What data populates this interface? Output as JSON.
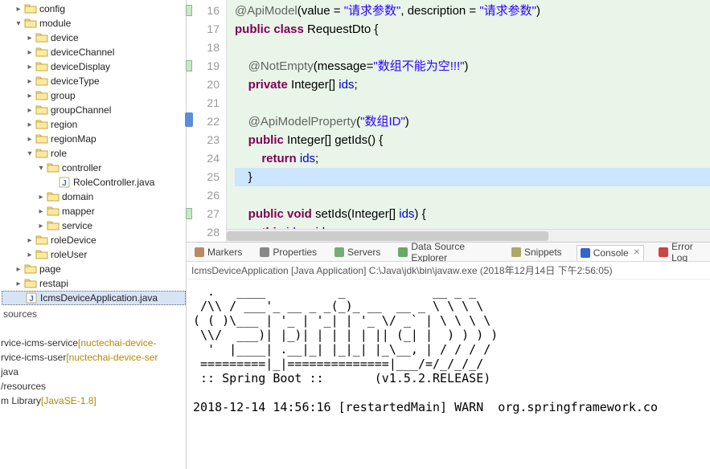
{
  "tree": {
    "nodes": [
      {
        "depth": 1,
        "tw": ">",
        "type": "folder",
        "label": "config"
      },
      {
        "depth": 1,
        "tw": "v",
        "type": "folder",
        "label": "module"
      },
      {
        "depth": 2,
        "tw": ">",
        "type": "folder",
        "label": "device"
      },
      {
        "depth": 2,
        "tw": ">",
        "type": "folder",
        "label": "deviceChannel"
      },
      {
        "depth": 2,
        "tw": ">",
        "type": "folder",
        "label": "deviceDisplay"
      },
      {
        "depth": 2,
        "tw": ">",
        "type": "folder",
        "label": "deviceType"
      },
      {
        "depth": 2,
        "tw": ">",
        "type": "folder",
        "label": "group"
      },
      {
        "depth": 2,
        "tw": ">",
        "type": "folder",
        "label": "groupChannel"
      },
      {
        "depth": 2,
        "tw": ">",
        "type": "folder",
        "label": "region"
      },
      {
        "depth": 2,
        "tw": ">",
        "type": "folder",
        "label": "regionMap"
      },
      {
        "depth": 2,
        "tw": "v",
        "type": "folder",
        "label": "role"
      },
      {
        "depth": 3,
        "tw": "v",
        "type": "folder",
        "label": "controller"
      },
      {
        "depth": 4,
        "tw": "",
        "type": "java",
        "label": "RoleController.java"
      },
      {
        "depth": 3,
        "tw": ">",
        "type": "folder",
        "label": "domain"
      },
      {
        "depth": 3,
        "tw": ">",
        "type": "folder",
        "label": "mapper"
      },
      {
        "depth": 3,
        "tw": ">",
        "type": "folder",
        "label": "service"
      },
      {
        "depth": 2,
        "tw": ">",
        "type": "folder",
        "label": "roleDevice"
      },
      {
        "depth": 2,
        "tw": ">",
        "type": "folder",
        "label": "roleUser"
      },
      {
        "depth": 1,
        "tw": ">",
        "type": "folder",
        "label": "page"
      },
      {
        "depth": 1,
        "tw": ">",
        "type": "folder",
        "label": "restapi"
      },
      {
        "depth": 1,
        "tw": "",
        "type": "java",
        "label": "IcmsDeviceApplication.java",
        "selected": true
      }
    ],
    "sources_label": "sources",
    "bottom": [
      {
        "label": "rvice-icms-service",
        "suffix": "[nuctechai-device-"
      },
      {
        "label": "rvice-icms-user",
        "suffix": "[nuctechai-device-ser"
      },
      {
        "label": "java",
        "suffix": ""
      },
      {
        "label": "/resources",
        "suffix": ""
      },
      {
        "label": "m Library",
        "suffix": "[JavaSE-1.8]"
      }
    ]
  },
  "code": {
    "colors": {
      "bg_hl": "#e8f5e8",
      "bg_cur": "#cce6ff"
    },
    "lines": [
      {
        "num": 16,
        "qf": true,
        "html": "<span class='ann'>@ApiModel</span>(value = <span class='str'>\"请求参数\"</span>, description = <span class='str'>\"请求参数\"</span>)"
      },
      {
        "num": 17,
        "qf": false,
        "html": "<span class='kw'>public class</span> RequestDto {"
      },
      {
        "num": 18,
        "qf": false,
        "html": ""
      },
      {
        "num": 19,
        "qf": true,
        "html": "    <span class='ann'>@NotEmpty</span>(message=<span class='str'>\"数组不能为空!!!\"</span>)"
      },
      {
        "num": 20,
        "qf": false,
        "html": "    <span class='kw'>private</span> Integer[] <span class='fld'>ids</span>;"
      },
      {
        "num": 21,
        "qf": false,
        "html": ""
      },
      {
        "num": 22,
        "qf": true,
        "bm": true,
        "html": "    <span class='ann'>@ApiModelProperty</span>(<span class='str'>\"数组ID\"</span>)"
      },
      {
        "num": 23,
        "qf": false,
        "html": "    <span class='kw'>public</span> Integer[] getIds() {"
      },
      {
        "num": 24,
        "qf": false,
        "html": "        <span class='kw'>return</span> <span class='fld'>ids</span>;"
      },
      {
        "num": 25,
        "qf": false,
        "cur": true,
        "html": "    }"
      },
      {
        "num": 26,
        "qf": false,
        "html": ""
      },
      {
        "num": 27,
        "qf": true,
        "html": "    <span class='kw'>public void</span> setIds(Integer[] <span class='fld'>ids</span>) {"
      },
      {
        "num": 28,
        "qf": false,
        "html": "        <span class='kw'>this</span>.<span class='fld'>ids</span> = ids;"
      }
    ]
  },
  "tabs": {
    "items": [
      {
        "label": "Markers",
        "icon": "markers"
      },
      {
        "label": "Properties",
        "icon": "props"
      },
      {
        "label": "Servers",
        "icon": "servers"
      },
      {
        "label": "Data Source Explorer",
        "icon": "db"
      },
      {
        "label": "Snippets",
        "icon": "snip"
      },
      {
        "label": "Console",
        "icon": "console",
        "active": true
      },
      {
        "label": "Error Log",
        "icon": "error"
      }
    ]
  },
  "launch": {
    "text": "IcmsDeviceApplication [Java Application] C:\\Java\\jdk\\bin\\javaw.exe (2018年12月14日 下午2:56:05)"
  },
  "console": {
    "banner": "  .   ____          _            __ _ _\n /\\\\ / ___'_ __ _ _(_)_ __  __ _ \\ \\ \\ \\\n( ( )\\___ | '_ | '_| | '_ \\/ _` | \\ \\ \\ \\\n \\\\/  ___)| |_)| | | | | || (_| |  ) ) ) )\n  '  |____| .__|_| |_|_| |_\\__, | / / / /\n =========|_|==============|___/=/_/_/_/\n :: Spring Boot ::       (v1.5.2.RELEASE)\n\n2018-12-14 14:56:16 [restartedMain] WARN  org.springframework.co"
  }
}
